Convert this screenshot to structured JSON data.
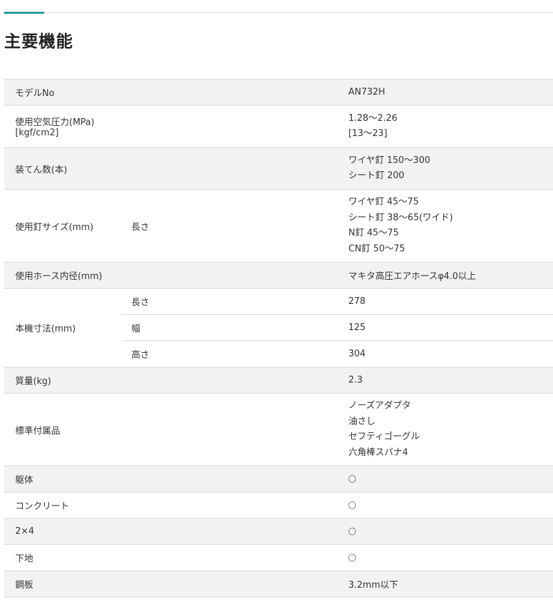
{
  "page": {
    "title": "主要機能"
  },
  "spec": {
    "model": {
      "label": "モデルNo",
      "value": "AN732H"
    },
    "pressure": {
      "label": "使用空気圧力(MPa)[kgf/cm2]",
      "values": [
        "1.28〜2.26",
        "[13〜23]"
      ]
    },
    "capacity": {
      "label": "装てん数(本)",
      "values": [
        "ワイヤ釘 150〜300",
        "シート釘 200"
      ]
    },
    "nail_size": {
      "label": "使用釘サイズ(mm)",
      "sub": "長さ",
      "values": [
        "ワイヤ釘 45〜75",
        "シート釘 38〜65(ワイド)",
        "N釘 45〜75",
        "CN釘 50〜75"
      ]
    },
    "hose": {
      "label": "使用ホース内径(mm)",
      "value": "マキタ高圧エアホースφ4.0以上"
    },
    "dimensions": {
      "label": "本機寸法(mm)",
      "rows": [
        {
          "sub": "長さ",
          "value": "278"
        },
        {
          "sub": "幅",
          "value": "125"
        },
        {
          "sub": "高さ",
          "value": "304"
        }
      ]
    },
    "mass": {
      "label": "質量(kg)",
      "value": "2.3"
    },
    "accessories": {
      "label": "標準付属品",
      "values": [
        "ノーズアダプタ",
        "油さし",
        "セフティゴーグル",
        "六角棒スパナ4"
      ]
    },
    "framing": {
      "label": "躯体",
      "mark": "circle-mark"
    },
    "concrete": {
      "label": "コンクリート",
      "mark": "circle-mark"
    },
    "two_by_four": {
      "label": "2×4",
      "mark": "circle-mark"
    },
    "subfloor": {
      "label": "下地",
      "mark": "circle-mark"
    },
    "steel_plate": {
      "label": "鋼板",
      "value": "3.2mm以下"
    }
  },
  "colors": {
    "accent": "#2a9d9b",
    "shade": "#f2f2f2",
    "border": "#d8d8d8"
  }
}
